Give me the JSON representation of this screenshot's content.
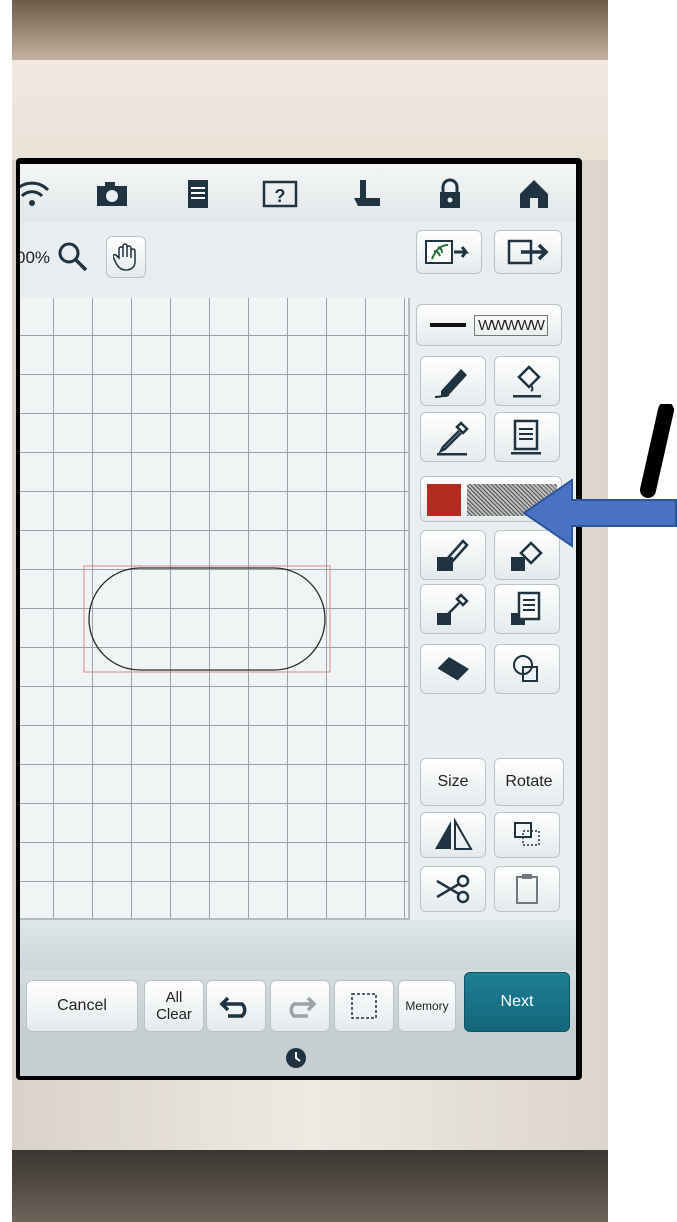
{
  "colors": {
    "accent": "#14667a",
    "swatch": "#b22a20",
    "arrow": "#4a72c4"
  },
  "topbar": {
    "icons": [
      "wifi-icon",
      "camera-icon",
      "document-icon",
      "help-icon",
      "presser-foot-icon",
      "lock-icon",
      "home-icon"
    ]
  },
  "toolbar": {
    "zoom_label": "00%",
    "zoom_icon": "magnifier-icon",
    "hand_icon": "hand-icon",
    "import_icon": "import-leaf-icon",
    "export_icon": "export-icon"
  },
  "side_panel": {
    "line_stitch": "WWWWW",
    "tools": [
      "pencil-icon",
      "fill-bucket-icon",
      "eyedropper-icon",
      "list-icon",
      "brush-icon",
      "fill-bucket-icon",
      "eyedropper-icon",
      "list-icon",
      "eraser-icon",
      "shape-icon"
    ],
    "swatch_color": "#b22a20",
    "size_label": "Size",
    "rotate_label": "Rotate"
  },
  "bottom": {
    "cancel": "Cancel",
    "all_clear": "All\nClear",
    "memory": "Memory",
    "next": "Next"
  },
  "status": {
    "clock_icon": "clock-icon"
  },
  "overlay": {
    "arrow_icon": "left-arrow-icon"
  }
}
